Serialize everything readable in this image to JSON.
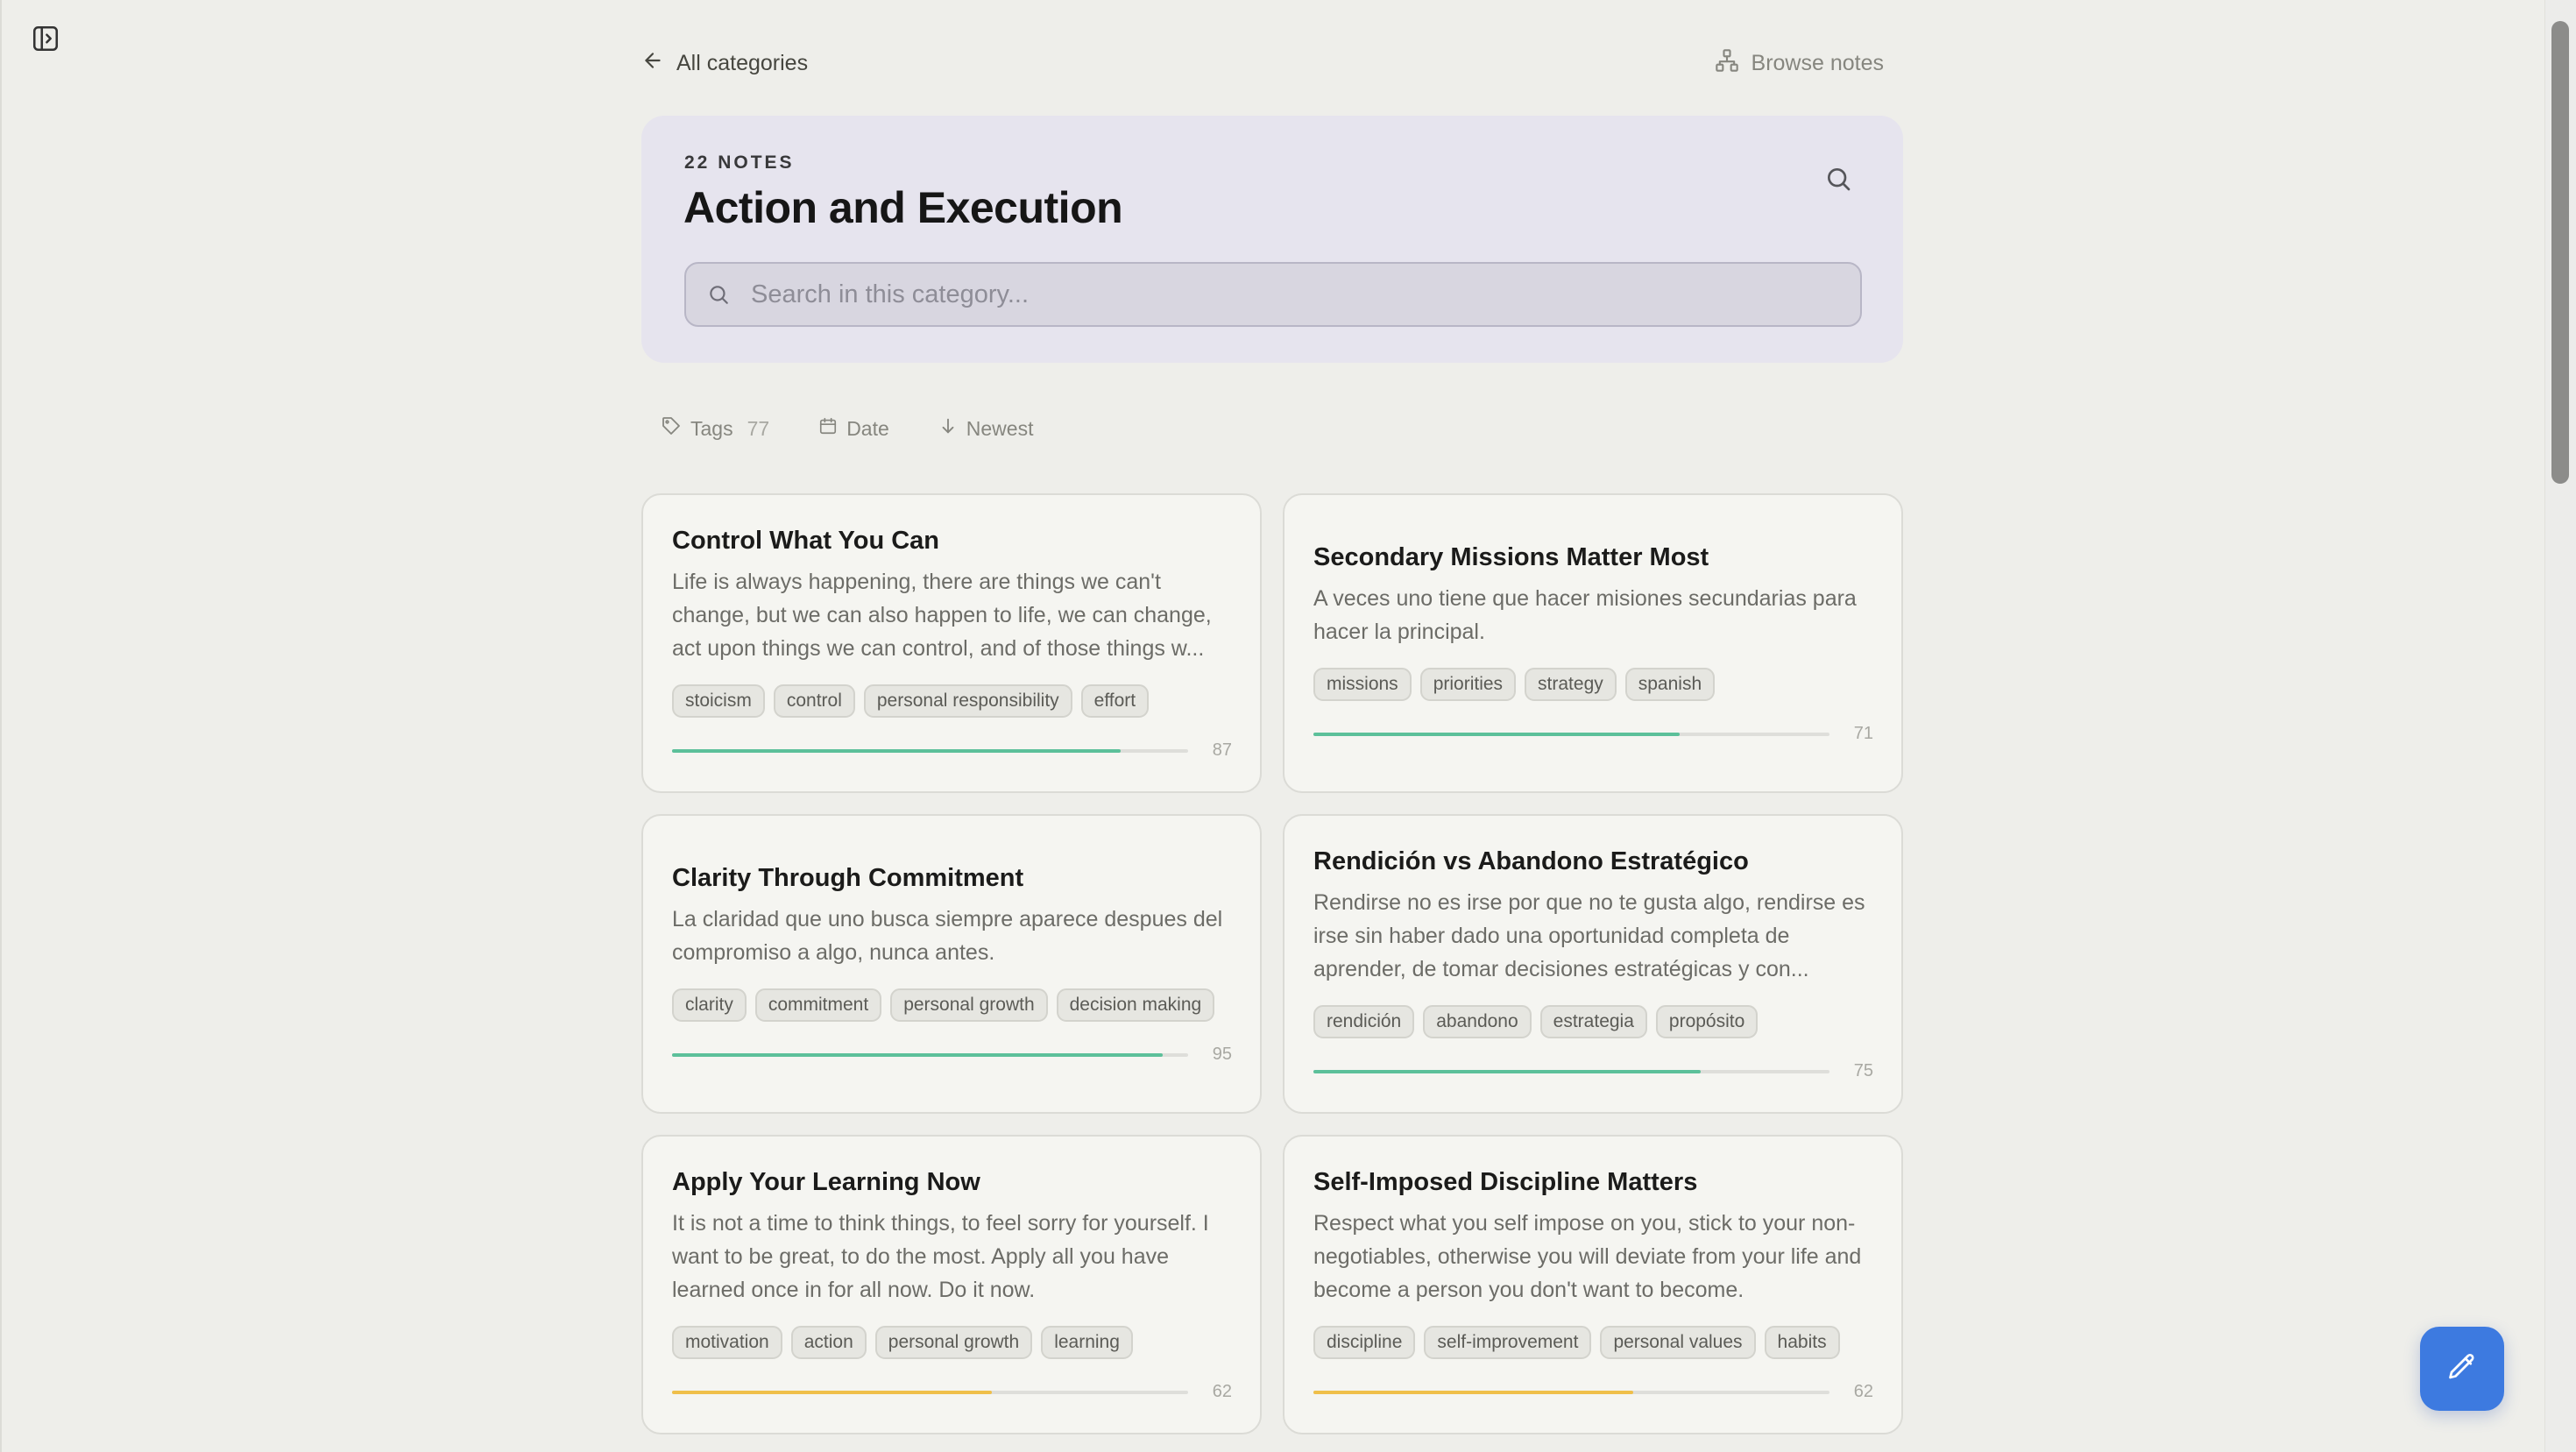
{
  "nav": {
    "back_label": "All categories",
    "browse_label": "Browse notes"
  },
  "header": {
    "notes_count": "22 NOTES",
    "title": "Action and Execution",
    "search_placeholder": "Search in this category..."
  },
  "filters": {
    "tags_label": "Tags",
    "tags_count": "77",
    "date_label": "Date",
    "sort_label": "Newest"
  },
  "notes": [
    {
      "title": "Control What You Can",
      "excerpt": "Life is always happening, there are things we can't change, but we can also happen to life, we can change, act upon things we can control, and of those things w...",
      "tags": [
        "stoicism",
        "control",
        "personal responsibility",
        "effort"
      ],
      "score": 87,
      "score_label": "87",
      "color": "#5cc09a"
    },
    {
      "title": "Secondary Missions Matter Most",
      "excerpt": "A veces uno tiene que hacer misiones secundarias para hacer la principal.",
      "tags": [
        "missions",
        "priorities",
        "strategy",
        "spanish"
      ],
      "score": 71,
      "score_label": "71",
      "color": "#5cc09a"
    },
    {
      "title": "Clarity Through Commitment",
      "excerpt": "La claridad que uno busca siempre aparece despues del compromiso a algo, nunca antes.",
      "tags": [
        "clarity",
        "commitment",
        "personal growth",
        "decision making"
      ],
      "score": 95,
      "score_label": "95",
      "color": "#5cc09a"
    },
    {
      "title": "Rendición vs Abandono Estratégico",
      "excerpt": "Rendirse no es irse por que no te gusta algo, rendirse es irse sin haber dado una oportunidad completa de aprender, de tomar decisiones estratégicas y con...",
      "tags": [
        "rendición",
        "abandono",
        "estrategia",
        "propósito"
      ],
      "score": 75,
      "score_label": "75",
      "color": "#5cc09a"
    },
    {
      "title": "Apply Your Learning Now",
      "excerpt": "It is not a time to think things, to feel sorry for yourself. I want to be great, to do the most. Apply all you have learned once in for all now. Do it now.",
      "tags": [
        "motivation",
        "action",
        "personal growth",
        "learning"
      ],
      "score": 62,
      "score_label": "62",
      "color": "#efbf4a"
    },
    {
      "title": "Self-Imposed Discipline Matters",
      "excerpt": "Respect what you self impose on you, stick to your non-negotiables, otherwise you will deviate from your life and become a person you don't want to become.",
      "tags": [
        "discipline",
        "self-improvement",
        "personal values",
        "habits"
      ],
      "score": 62,
      "score_label": "62",
      "color": "#efbf4a"
    }
  ],
  "icons": {
    "sidebar_toggle": "sidebar-toggle-icon",
    "back": "arrow-left-icon",
    "browse": "network-icon",
    "search": "search-icon",
    "tag": "tag-icon",
    "date": "calendar-icon",
    "sort": "arrow-down-icon",
    "fab": "pencil-icon"
  },
  "colors": {
    "background": "#eeeeea",
    "header_card": "#e6e4ee",
    "accent": "#3d7ae0",
    "progress_high": "#5cc09a",
    "progress_mid": "#efbf4a"
  }
}
